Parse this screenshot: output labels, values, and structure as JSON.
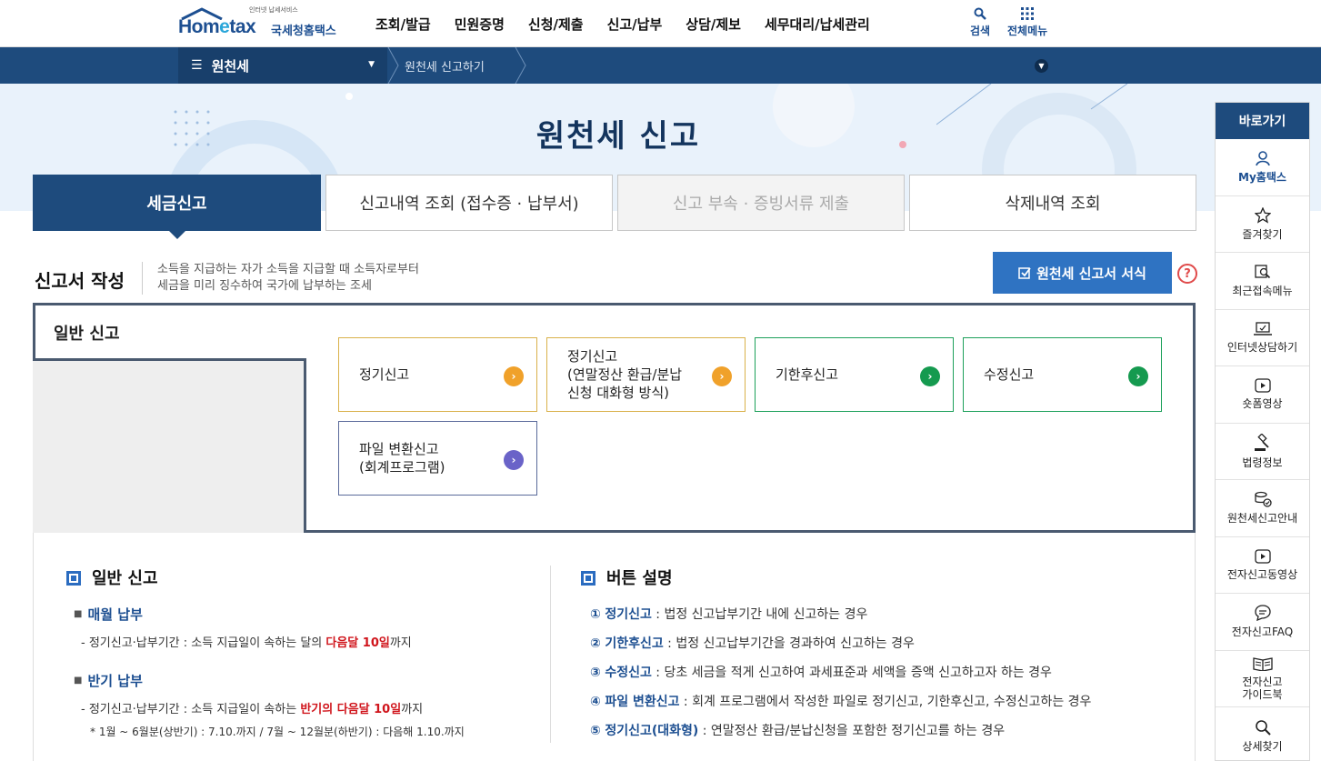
{
  "header": {
    "logo_small": "인터넷 납세서비스",
    "logo_main_a": "Hom",
    "logo_main_e": "e",
    "logo_main_b": "tax",
    "logo_name": "국세청홈택스",
    "gnb": [
      "조회/발급",
      "민원증명",
      "신청/제출",
      "신고/납부",
      "상담/제보",
      "세무대리/납세관리"
    ],
    "search_label": "검색",
    "allmenu_label": "전체메뉴"
  },
  "pathbar": {
    "menu_label": "원천세",
    "crumb": "원천세 신고하기"
  },
  "hero": {
    "title": "원천세  신고"
  },
  "tabs": [
    {
      "label": "세금신고",
      "state": "active"
    },
    {
      "label": "신고내역 조회 (접수증 · 납부서)",
      "state": "normal"
    },
    {
      "label": "신고 부속 · 증빙서류 제출",
      "state": "disabled"
    },
    {
      "label": "삭제내역 조회",
      "state": "normal"
    }
  ],
  "section": {
    "title": "신고서 작성",
    "desc_1": "소득을 지급하는 자가 소득을 지급할 때 소득자로부터",
    "desc_2": "세금을 미리 징수하여 국가에 납부하는 조세",
    "form_button": "원천세 신고서 서식",
    "help": "?"
  },
  "filing": {
    "subtab": "일반 신고",
    "buttons": {
      "regular": "정기신고",
      "regular_dialog_1": "정기신고",
      "regular_dialog_2": "(연말정산 환급/분납",
      "regular_dialog_3": "신청 대화형 방식)",
      "late": "기한후신고",
      "amend": "수정신고",
      "file_1": "파일 변환신고",
      "file_2": "(회계프로그램)"
    }
  },
  "info": {
    "left_title": "일반 신고",
    "monthly_title": "매월 납부",
    "monthly_text_a": "정기신고·납부기간 : 소득 지급일이 속하는 달의 ",
    "monthly_text_red": "다음달 10일",
    "monthly_text_b": "까지",
    "half_title": "반기 납부",
    "half_text_a": "정기신고·납부기간 : 소득 지급일이 속하는 ",
    "half_text_red": "반기의 다음달 10일",
    "half_text_b": "까지",
    "half_note": "* 1월 ~ 6월분(상반기) : 7.10.까지 / 7월 ~ 12월분(하반기) : 다음해 1.10.까지",
    "right_title": "버튼 설명",
    "desc": [
      {
        "num": "①",
        "name": "정기신고",
        "text": " : 법정 신고납부기간 내에 신고하는 경우"
      },
      {
        "num": "②",
        "name": "기한후신고",
        "text": " : 법정 신고납부기간을 경과하여 신고하는 경우"
      },
      {
        "num": "③",
        "name": "수정신고",
        "text": " : 당초 세금을 적게 신고하여 과세표준과 세액을 증액 신고하고자 하는 경우"
      },
      {
        "num": "④",
        "name": "파일 변환신고",
        "text": " : 회계 프로그램에서 작성한 파일로 정기신고, 기한후신고, 수정신고하는 경우"
      },
      {
        "num": "⑤",
        "name": "정기신고(대화형)",
        "text": " : 연말정산 환급/분납신청을 포함한 정기신고를 하는 경우"
      }
    ]
  },
  "quick": {
    "title": "바로가기",
    "items": [
      "My홈택스",
      "즐겨찾기",
      "최근접속메뉴",
      "인터넷상담하기",
      "숏폼영상",
      "법령정보",
      "원천세신고안내",
      "전자신고동영상",
      "전자신고FAQ",
      "전자신고\n가이드북",
      "상세찾기"
    ]
  },
  "colors": {
    "navy": "#1e4b7d",
    "accent_blue": "#2f73c2",
    "orange": "#f0a12a",
    "green": "#159a4f",
    "red": "#d0151c"
  }
}
